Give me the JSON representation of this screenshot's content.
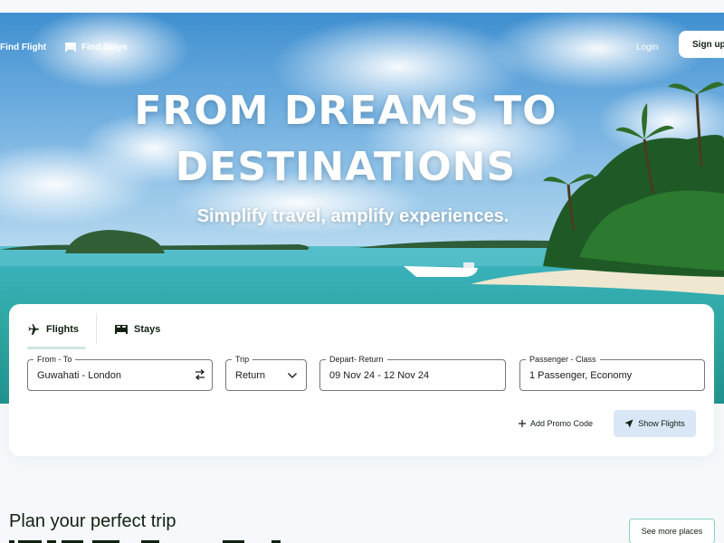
{
  "nav": {
    "find_flight": "Find Flight",
    "find_stays": "Find Stays",
    "login": "Login",
    "signup": "Sign up"
  },
  "hero": {
    "title_line1": "FROM DREAMS TO",
    "title_line2": "DESTINATIONS",
    "subtitle": "Simplify travel, amplify experiences."
  },
  "search": {
    "tabs": [
      {
        "label": "Flights",
        "icon": "airplane-icon",
        "active": true
      },
      {
        "label": "Stays",
        "icon": "bed-icon",
        "active": false
      }
    ],
    "fields": {
      "from_to": {
        "label": "From - To",
        "value": "Guwahati - London"
      },
      "trip": {
        "label": "Trip",
        "value": "Return"
      },
      "dates": {
        "label": "Depart- Return",
        "value": "09 Nov 24 - 12 Nov 24"
      },
      "passenger": {
        "label": "Passenger - Class",
        "value": "1 Passenger, Economy"
      }
    },
    "promo_label": "Add Promo Code",
    "show_flights_label": "Show Flights"
  },
  "section": {
    "title": "Plan your perfect trip",
    "see_more_label": "See more places"
  },
  "colors": {
    "accent": "#8dd3bb",
    "button_bg": "#d9e7f7",
    "text": "#112211"
  }
}
